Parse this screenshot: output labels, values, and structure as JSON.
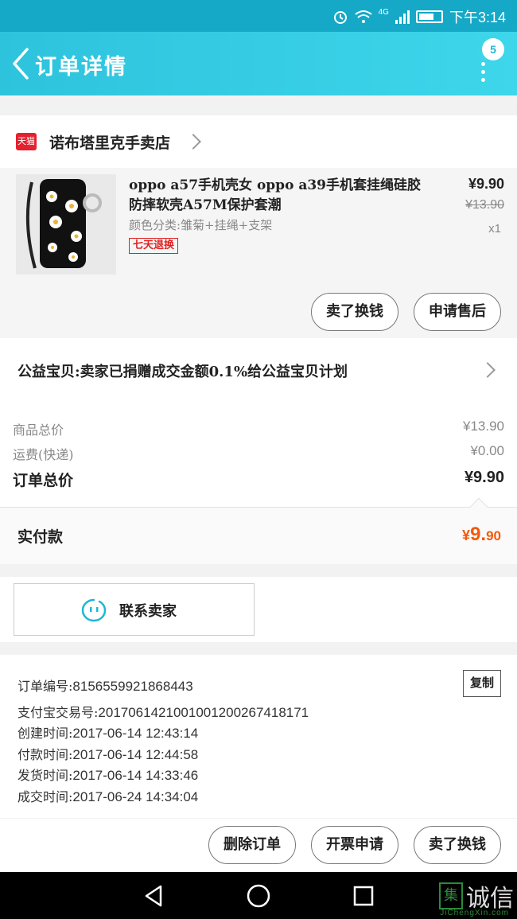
{
  "status_bar": {
    "network": "4G",
    "time": "下午3:14"
  },
  "header": {
    "title": "订单详情",
    "badge_count": "5"
  },
  "shop": {
    "platform_label": "天猫",
    "name": "诺布塔里克手卖店"
  },
  "product": {
    "title": "oppo a57手机壳女 oppo a39手机套挂绳硅胶防摔软壳A57M保护套潮",
    "sku": "颜色分类:雏菊+挂绳+支架",
    "tag": "七天退换",
    "price": "¥9.90",
    "original_price": "¥13.90",
    "quantity": "x1",
    "buttons": {
      "exchange": "卖了换钱",
      "after_sales": "申请售后"
    }
  },
  "charity": {
    "text": "公益宝贝:卖家已捐赠成交金额0.1%给公益宝贝计划"
  },
  "pricing": {
    "goods_total_label": "商品总价",
    "goods_total": "¥13.90",
    "shipping_label": "运费(快递)",
    "shipping": "¥0.00",
    "order_total_label": "订单总价",
    "order_total": "¥9.90"
  },
  "payment": {
    "label": "实付款",
    "symbol": "¥",
    "integer": "9.",
    "decimal": "90"
  },
  "contact": {
    "label": "联系卖家"
  },
  "order_info": {
    "order_no_label": "订单编号:",
    "order_no": "8156559921868443",
    "copy_label": "复制",
    "alipay_label": "支付宝交易号:",
    "alipay_no": "2017061421001001200267418171",
    "created_label": "创建时间:",
    "created": "2017-06-14 12:43:14",
    "paid_label": "付款时间:",
    "paid": "2017-06-14 12:44:58",
    "shipped_label": "发货时间:",
    "shipped": "2017-06-14 14:33:46",
    "completed_label": "成交时间:",
    "completed": "2017-06-24 14:34:04"
  },
  "bottom_actions": {
    "delete": "删除订单",
    "invoice": "开票申请",
    "exchange": "卖了换钱"
  },
  "watermark": {
    "box_char": "集",
    "text": "诚信",
    "sub": "JiChengXin.com"
  },
  "icons": {
    "status": [
      "alarm-icon",
      "wifi-icon",
      "signal-icon",
      "battery-icon"
    ],
    "nav": [
      "back-arrow-icon",
      "more-dots-icon"
    ],
    "system": [
      "nav-back-triangle-icon",
      "nav-home-circle-icon",
      "nav-recents-square-icon"
    ]
  },
  "colors": {
    "header_bg": "#2ec3dd",
    "status_bg": "#16a8c7",
    "accent_orange": "#f25a0a",
    "tag_red": "#e02020",
    "contact_icon": "#1eb7d4"
  }
}
